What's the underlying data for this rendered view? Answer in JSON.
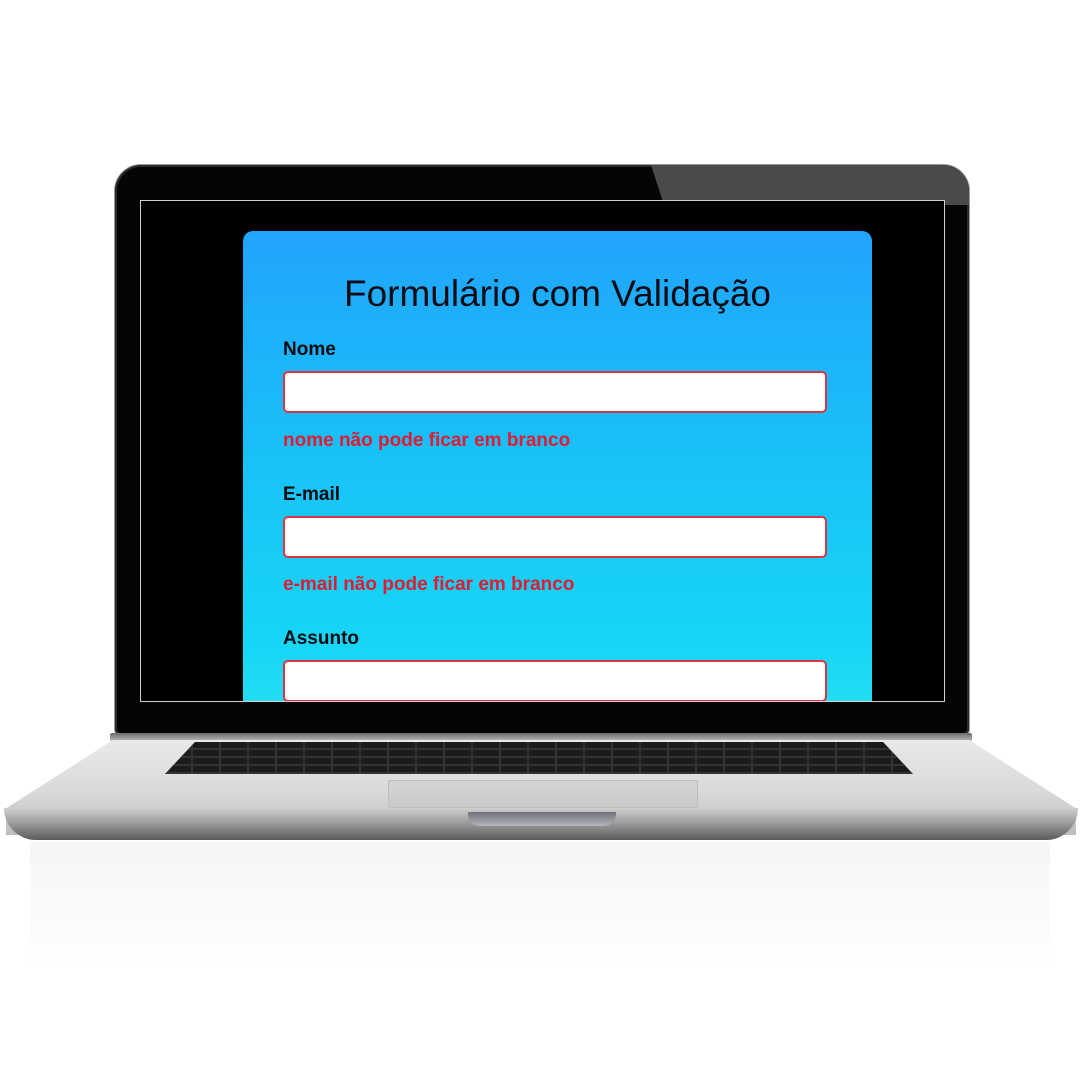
{
  "form": {
    "title": "Formulário com Validação",
    "fields": [
      {
        "label": "Nome",
        "value": "",
        "error": "nome não pode ficar em branco"
      },
      {
        "label": "E-mail",
        "value": "",
        "error": "e-mail não pode ficar em branco"
      },
      {
        "label": "Assunto",
        "value": "",
        "error": ""
      }
    ]
  },
  "colors": {
    "card_gradient_top": "#22a4fb",
    "card_gradient_bottom": "#2fe3ef",
    "error_text": "#e01b32",
    "input_border_error": "#d9344a"
  },
  "device": {
    "type": "laptop-mockup-icon"
  }
}
